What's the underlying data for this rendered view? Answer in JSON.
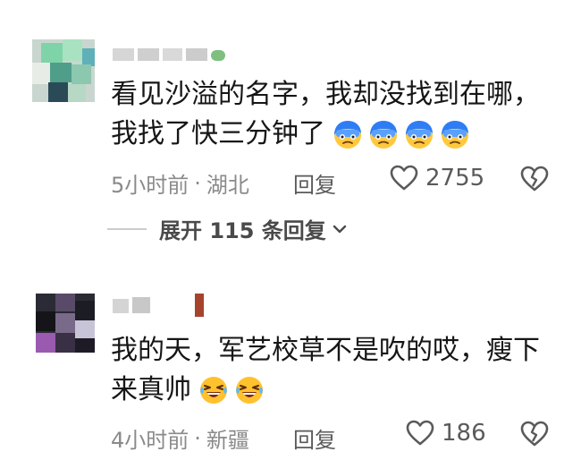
{
  "comments": [
    {
      "username": "",
      "text_lines": [
        "看见沙溢的名字，我却没找到在哪，",
        "我找了快三分钟了"
      ],
      "time": "5小时前",
      "separator": "·",
      "location": "湖北",
      "reply_label": "回复",
      "likes": "2755",
      "emojis": [
        "crying-blue-face-emoji",
        "crying-blue-face-emoji",
        "crying-blue-face-emoji",
        "crying-blue-face-emoji"
      ]
    },
    {
      "username": "",
      "text_lines": [
        "我的天，军艺校草不是吹的哎，瘦下",
        "来真帅"
      ],
      "time": "4小时前",
      "separator": "·",
      "location": "新疆",
      "reply_label": "回复",
      "likes": "186",
      "emojis": [
        "laughing-tears-face-emoji",
        "laughing-tears-face-emoji"
      ]
    }
  ],
  "expand_replies": {
    "label": "展开 115 条回复",
    "icon": "chevron-down-icon"
  },
  "colors": {
    "text": "#161616",
    "meta": "#8a8a8a",
    "action": "#5a5a5a",
    "emoji_blue": "#2f7df6",
    "emoji_yellow": "#ffb800"
  }
}
